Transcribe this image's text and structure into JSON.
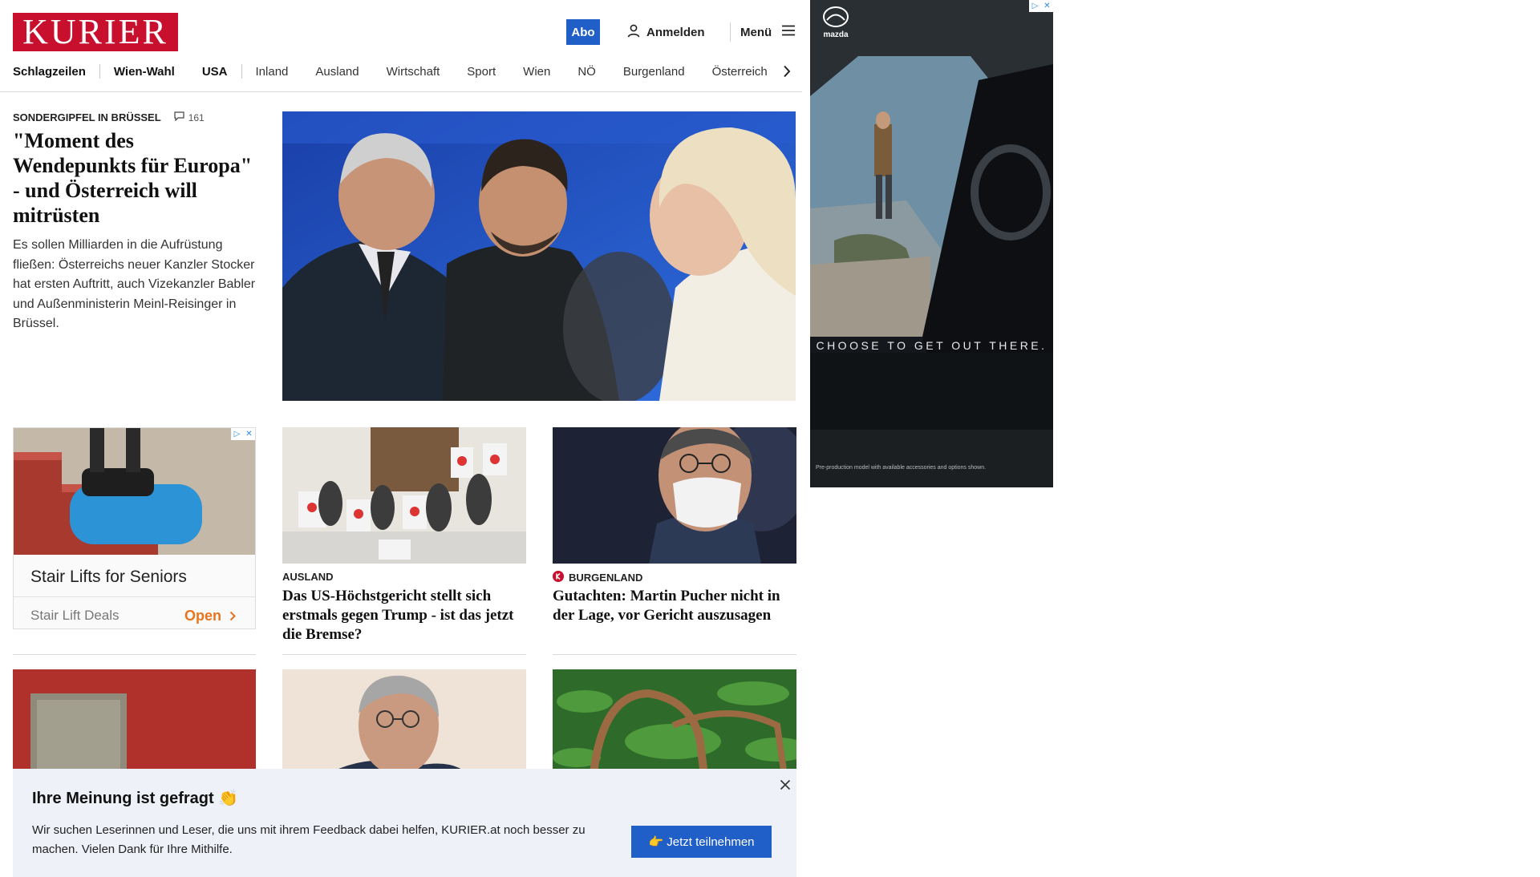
{
  "header": {
    "logo_text": "KURIER",
    "subscribe_label": "Abo",
    "login_label": "Anmelden",
    "menu_label": "Menü",
    "brand_color": "#c8102e",
    "accent_color": "#1f5fc7"
  },
  "nav": {
    "items": [
      "Schlagzeilen",
      "Wien-Wahl",
      "USA",
      "Inland",
      "Ausland",
      "Wirtschaft",
      "Sport",
      "Wien",
      "NÖ",
      "Burgenland",
      "Österreich"
    ],
    "next_icon": "chevron-right-icon"
  },
  "hero": {
    "kicker": "SONDERGIPFEL IN BRÜSSEL",
    "comment_count": "161",
    "headline": "\"Moment des Wendepunkts für Europa\" - und Österreich will mitrüsten",
    "teaser": "Es sollen Milliarden in die Aufrüstung fließen: Österreichs neuer Kanzler Stocker hat ersten Auftritt, auch Vizekanzler Babler und Außenministerin Meinl-Reisinger in Brüssel."
  },
  "ad_stairlift": {
    "title": "Stair Lifts for Seniors",
    "sponsor": "Stair Lift Deals",
    "cta": "Open"
  },
  "articles": [
    {
      "kicker": "AUSLAND",
      "title": "Das US-Höchstgericht stellt sich erstmals gegen Trump - ist das jetzt die Bremse?"
    },
    {
      "kicker": "BURGENLAND",
      "title": "Gutachten: Martin Pucher nicht in der Lage, vor Gericht auszusagen"
    }
  ],
  "ad_mazda": {
    "brand": "mazda",
    "tagline": "CHOOSE TO GET OUT THERE.",
    "footnote": "Pre-production model with available accessories and options shown."
  },
  "survey": {
    "title": "Ihre Meinung ist gefragt 👏",
    "text": "Wir suchen Leserinnen und Leser, die uns mit ihrem Feedback dabei helfen, KURIER.at noch besser zu machen. Vielen Dank für Ihre Mithilfe.",
    "cta": "👉 Jetzt teilnehmen"
  }
}
